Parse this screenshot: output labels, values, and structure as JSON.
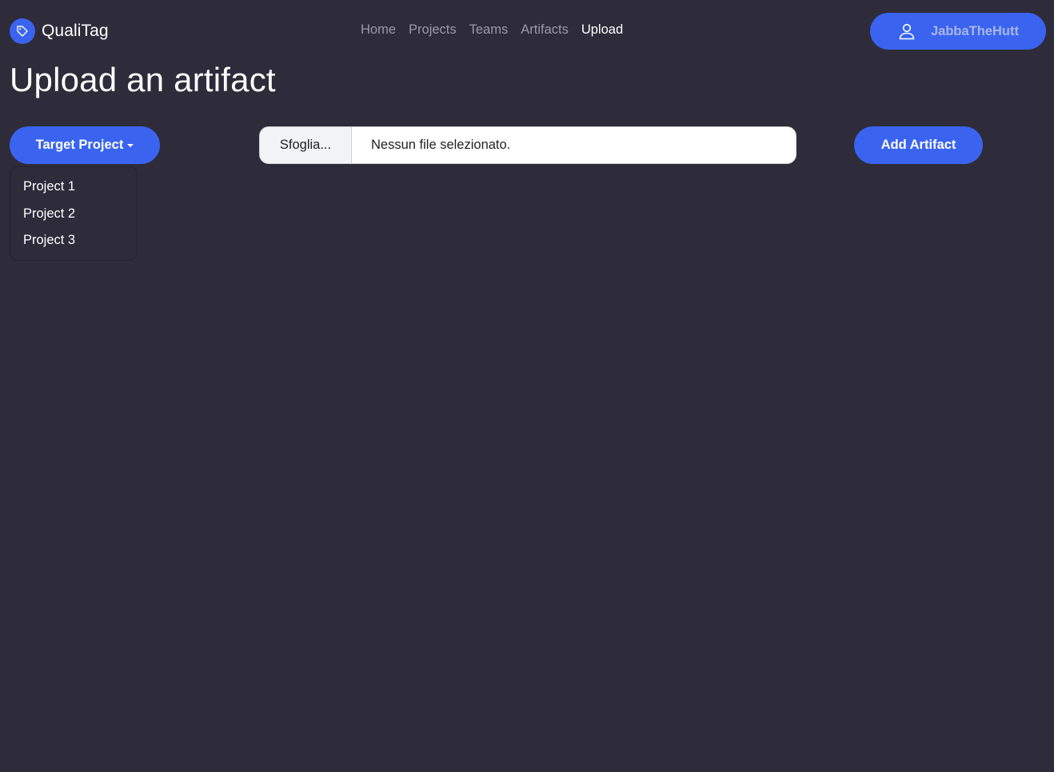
{
  "brand": {
    "name": "QualiTag",
    "icon": "tag-icon"
  },
  "nav": {
    "links": [
      {
        "label": "Home",
        "active": false
      },
      {
        "label": "Projects",
        "active": false
      },
      {
        "label": "Teams",
        "active": false
      },
      {
        "label": "Artifacts",
        "active": false
      },
      {
        "label": "Upload",
        "active": true
      }
    ]
  },
  "user": {
    "name": "JabbaTheHutt",
    "icon": "user-icon"
  },
  "page": {
    "title": "Upload an artifact"
  },
  "target_project": {
    "label": "Target Project",
    "options": [
      "Project 1",
      "Project 2",
      "Project 3"
    ]
  },
  "file_input": {
    "browse_label": "Sfoglia...",
    "status": "Nessun file selezionato."
  },
  "add_button": {
    "label": "Add Artifact"
  },
  "colors": {
    "background": "#2e2c3a",
    "accent": "#3a64f0",
    "nav_inactive": "#9b9aa6",
    "user_name": "#a9b6e6"
  }
}
